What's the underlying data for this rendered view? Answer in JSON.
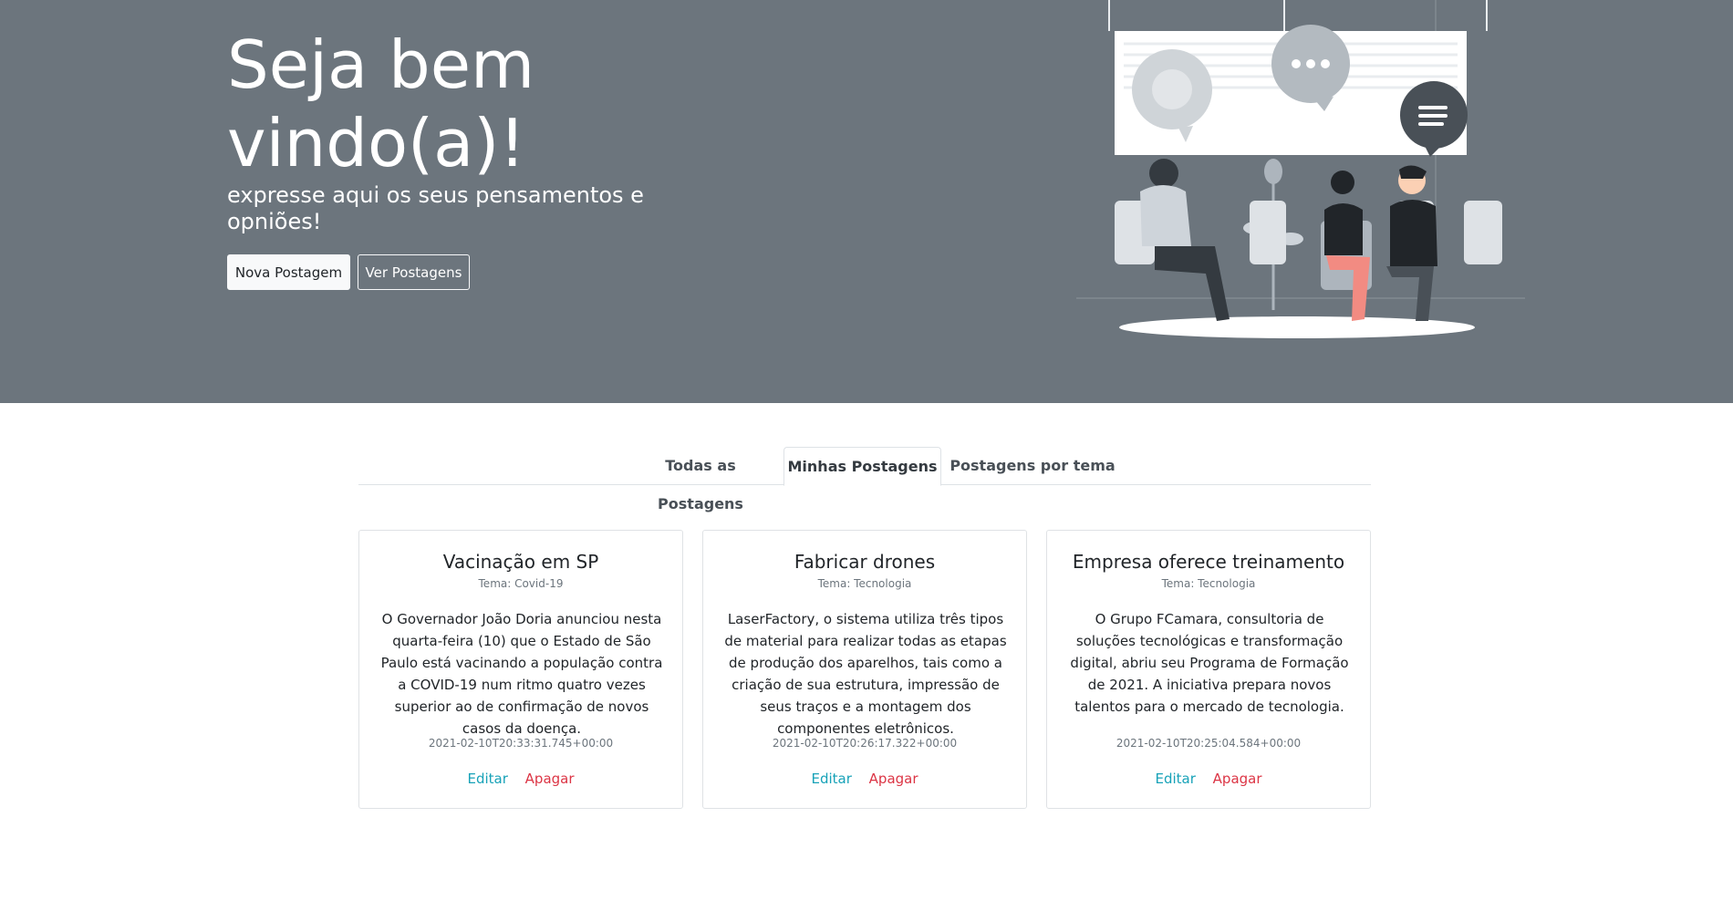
{
  "hero": {
    "title": "Seja bem vindo(a)!",
    "subtitle": "expresse aqui os seus pensamentos e opniões!",
    "new_post_button": "Nova Postagem",
    "view_posts_button": "Ver Postagens",
    "illustration": "people-meeting-illustration"
  },
  "tabs": [
    {
      "label": "Todas as Postagens",
      "active": false
    },
    {
      "label": "Minhas Postagens",
      "active": true
    },
    {
      "label": "Postagens por tema",
      "active": false
    }
  ],
  "posts": [
    {
      "title": "Vacinação em SP",
      "theme": "Tema: Covid-19",
      "text": "O Governador João Doria anunciou nesta quarta-feira (10) que o Estado de São Paulo está vacinando a população contra a COVID-19 num ritmo quatro vezes superior ao de confirmação de novos casos da doença.",
      "date": "2021-02-10T20:33:31.745+00:00",
      "edit_label": "Editar",
      "delete_label": "Apagar"
    },
    {
      "title": "Fabricar drones",
      "theme": "Tema: Tecnologia",
      "text": "LaserFactory, o sistema utiliza três tipos de material para realizar todas as etapas de produção dos aparelhos, tais como a criação de sua estrutura, impressão de seus traços e a montagem dos componentes eletrônicos.",
      "date": "2021-02-10T20:26:17.322+00:00",
      "edit_label": "Editar",
      "delete_label": "Apagar"
    },
    {
      "title": "Empresa oferece treinamento",
      "theme": "Tema: Tecnologia",
      "text": "O Grupo FCamara, consultoria de soluções tecnológicas e transformação digital, abriu seu Programa de Formação de 2021. A iniciativa prepara novos talentos para o mercado de tecnologia.",
      "date": "2021-02-10T20:25:04.584+00:00",
      "edit_label": "Editar",
      "delete_label": "Apagar"
    }
  ],
  "colors": {
    "hero_bg": "#6c757d",
    "edit_link": "#17a2b8",
    "delete_link": "#dc3545"
  }
}
